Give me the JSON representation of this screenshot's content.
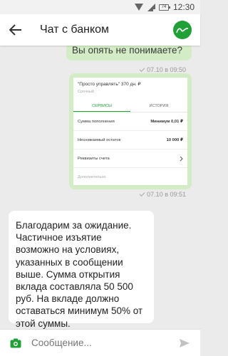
{
  "status_bar": {
    "battery": "74",
    "time": "12:30"
  },
  "header": {
    "title": "Чат с банком"
  },
  "messages": {
    "outgoing_text": "Вы опять не понимаете?",
    "outgoing_meta": "07.10 в 09:50",
    "card": {
      "title": "\"Просто управлять\" 370 дн. ₽",
      "subtitle": "Срочный",
      "tabs": [
        "СЕРВИСЫ",
        "ИСТОРИЯ"
      ],
      "rows": [
        {
          "label": "Сумма пополнения",
          "value": "Минимум 0,01 ₽"
        },
        {
          "label": "Неснижаемый остаток",
          "value": "10 000 ₽"
        },
        {
          "label": "Реквизиты счета",
          "value": ""
        }
      ],
      "more": "Дополнительно"
    },
    "card_meta": "07.10 в 09:51",
    "incoming_text": "Благодарим за ожидание. Частичное изъятие возможно на условиях, указанных в сообщении выше. Сумма открытия вклада составляла 50 500 руб. На вкладе должно оставаться минимум 50% от этой суммы."
  },
  "composer": {
    "placeholder": "Сообщение..."
  },
  "colors": {
    "accent": "#21a038",
    "outgoing_bubble": "#d4ecc6",
    "background": "#ebebeb"
  },
  "icons": {
    "back": "arrow-left-icon",
    "logo": "sberbank-logo",
    "camera": "camera-icon",
    "send": "send-icon"
  }
}
